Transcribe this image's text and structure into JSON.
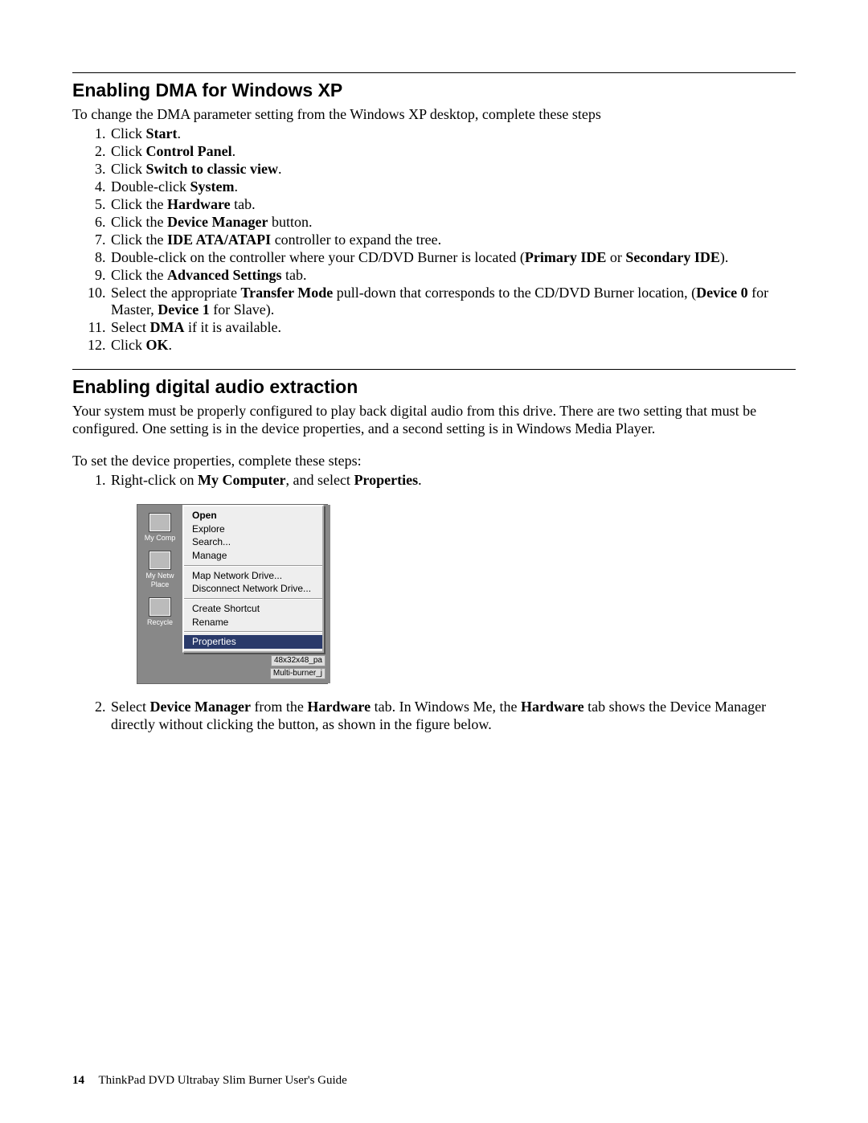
{
  "section1": {
    "title": "Enabling DMA for Windows XP",
    "intro": "To change the DMA parameter setting from the Windows XP desktop, complete these steps",
    "s1a": "Click ",
    "s1b": "Start",
    "s1c": ".",
    "s2a": "Click ",
    "s2b": "Control Panel",
    "s2c": ".",
    "s3a": "Click ",
    "s3b": "Switch to classic view",
    "s3c": ".",
    "s4a": "Double-click ",
    "s4b": "System",
    "s4c": ".",
    "s5a": "Click the ",
    "s5b": "Hardware",
    "s5c": " tab.",
    "s6a": "Click the ",
    "s6b": "Device Manager",
    "s6c": " button.",
    "s7a": "Click the ",
    "s7b": "IDE ATA/ATAPI",
    "s7c": " controller to expand the tree.",
    "s8a": "Double-click on the controller where your CD/DVD Burner is located (",
    "s8b": "Primary IDE",
    "s8c": " or ",
    "s8d": "Secondary IDE",
    "s8e": ").",
    "s9a": "Click the ",
    "s9b": "Advanced Settings",
    "s9c": " tab.",
    "s10a": "Select the appropriate ",
    "s10b": "Transfer Mode",
    "s10c": " pull-down that corresponds to the CD/DVD Burner location, (",
    "s10d": "Device 0",
    "s10e": " for Master, ",
    "s10f": "Device 1",
    "s10g": " for Slave).",
    "s11a": "Select ",
    "s11b": "DMA",
    "s11c": " if it is available.",
    "s12a": "Click ",
    "s12b": "OK",
    "s12c": "."
  },
  "section2": {
    "title": "Enabling digital audio extraction",
    "intro1": "Your system must be properly configured to play back digital audio from this drive. There are two setting that must be configured. One setting is in the device properties, and a second setting is in Windows Media Player.",
    "intro2": "To set the device properties, complete these steps:",
    "s1a": "Right-click on ",
    "s1b": "My Computer",
    "s1c": ", and select ",
    "s1d": "Properties",
    "s1e": ".",
    "s2a": "Select ",
    "s2b": "Device Manager",
    "s2c": " from the ",
    "s2d": "Hardware",
    "s2e": " tab. In Windows Me, the ",
    "s2f": "Hardware",
    "s2g": " tab shows the Device Manager directly without clicking the button, as shown in the figure below."
  },
  "ctxmenu": {
    "open": "Open",
    "explore": "Explore",
    "search": "Search...",
    "manage": "Manage",
    "mapdrive": "Map Network Drive...",
    "discdrive": "Disconnect Network Drive...",
    "shortcut": "Create Shortcut",
    "rename": "Rename",
    "properties": "Properties"
  },
  "desktop": {
    "mycomp": "My Comp",
    "mynet1": "My Netw",
    "mynet2": "Place",
    "recycle": "Recycle"
  },
  "belowmenu": {
    "l1": "48x32x48_pa",
    "l2": "Multi-burner_j"
  },
  "footer": {
    "pagenum": "14",
    "title": "ThinkPad DVD Ultrabay Slim Burner User's Guide"
  }
}
